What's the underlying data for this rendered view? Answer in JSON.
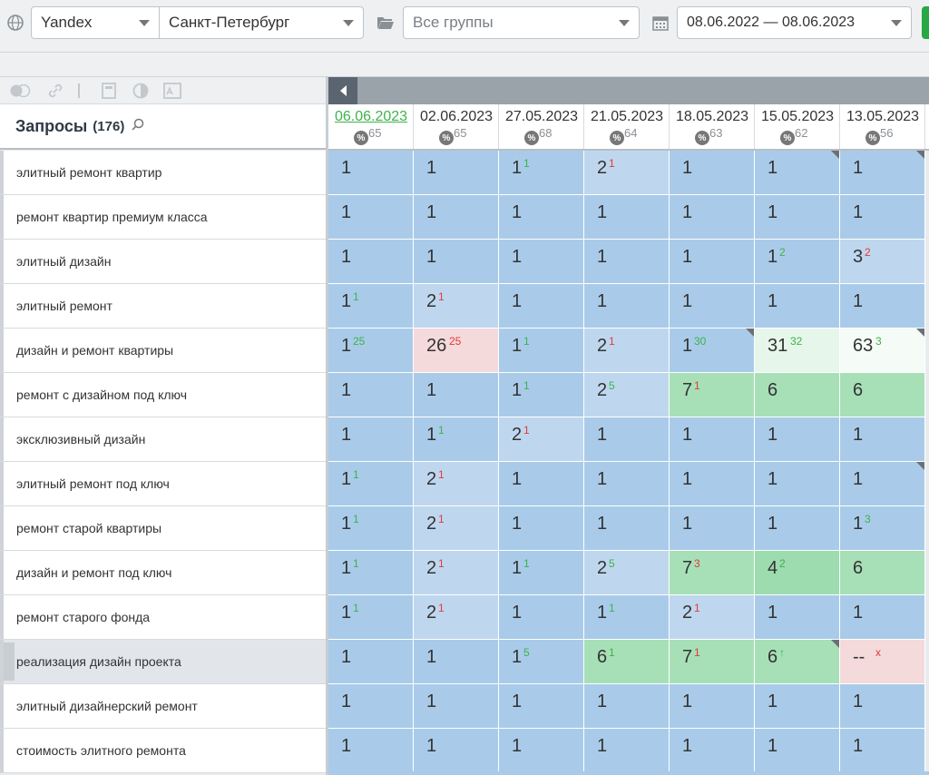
{
  "toolbar": {
    "engine": "Yandex",
    "city": "Санкт-Петербург",
    "groups_placeholder": "Все группы",
    "date_range": "08.06.2022 — 08.06.2023"
  },
  "queries_panel": {
    "title": "Запросы",
    "count": "(176)"
  },
  "columns": [
    {
      "date": "06.06.2023",
      "pct": "65",
      "highlight": true
    },
    {
      "date": "02.06.2023",
      "pct": "65"
    },
    {
      "date": "27.05.2023",
      "pct": "68"
    },
    {
      "date": "21.05.2023",
      "pct": "64"
    },
    {
      "date": "18.05.2023",
      "pct": "63"
    },
    {
      "date": "15.05.2023",
      "pct": "62"
    },
    {
      "date": "13.05.2023",
      "pct": "56"
    }
  ],
  "rows": [
    {
      "query": "элитный ремонт квартир",
      "cells": [
        {
          "v": "1",
          "c": "blue"
        },
        {
          "v": "1",
          "c": "blue"
        },
        {
          "v": "1",
          "d": "1",
          "dir": "up",
          "c": "blue"
        },
        {
          "v": "2",
          "d": "1",
          "dir": "down",
          "c": "lblue"
        },
        {
          "v": "1",
          "c": "blue"
        },
        {
          "v": "1",
          "c": "blue",
          "corner": true
        },
        {
          "v": "1",
          "c": "blue",
          "corner": true
        }
      ]
    },
    {
      "query": "ремонт квартир премиум класса",
      "cells": [
        {
          "v": "1",
          "c": "blue"
        },
        {
          "v": "1",
          "c": "blue"
        },
        {
          "v": "1",
          "c": "blue"
        },
        {
          "v": "1",
          "c": "blue"
        },
        {
          "v": "1",
          "c": "blue"
        },
        {
          "v": "1",
          "c": "blue"
        },
        {
          "v": "1",
          "c": "blue"
        }
      ]
    },
    {
      "query": "элитный дизайн",
      "cells": [
        {
          "v": "1",
          "c": "blue"
        },
        {
          "v": "1",
          "c": "blue"
        },
        {
          "v": "1",
          "c": "blue"
        },
        {
          "v": "1",
          "c": "blue"
        },
        {
          "v": "1",
          "c": "blue"
        },
        {
          "v": "1",
          "d": "2",
          "dir": "up",
          "c": "blue"
        },
        {
          "v": "3",
          "d": "2",
          "dir": "down",
          "c": "lblue"
        }
      ]
    },
    {
      "query": "элитный ремонт",
      "cells": [
        {
          "v": "1",
          "d": "1",
          "dir": "up",
          "c": "blue"
        },
        {
          "v": "2",
          "d": "1",
          "dir": "down",
          "c": "lblue"
        },
        {
          "v": "1",
          "c": "blue"
        },
        {
          "v": "1",
          "c": "blue"
        },
        {
          "v": "1",
          "c": "blue"
        },
        {
          "v": "1",
          "c": "blue"
        },
        {
          "v": "1",
          "c": "blue"
        }
      ]
    },
    {
      "query": "дизайн и ремонт квартиры",
      "cells": [
        {
          "v": "1",
          "d": "25",
          "dir": "up",
          "c": "blue"
        },
        {
          "v": "26",
          "d": "25",
          "dir": "down",
          "c": "pink"
        },
        {
          "v": "1",
          "d": "1",
          "dir": "up",
          "c": "blue"
        },
        {
          "v": "2",
          "d": "1",
          "dir": "down",
          "c": "lblue"
        },
        {
          "v": "1",
          "d": "30",
          "dir": "up",
          "c": "blue",
          "corner": true
        },
        {
          "v": "31",
          "d": "32",
          "dir": "up",
          "c": "pale"
        },
        {
          "v": "63",
          "d": "3",
          "dir": "up",
          "c": "white",
          "corner": true
        }
      ]
    },
    {
      "query": "ремонт с дизайном под ключ",
      "cells": [
        {
          "v": "1",
          "c": "blue"
        },
        {
          "v": "1",
          "c": "blue"
        },
        {
          "v": "1",
          "d": "1",
          "dir": "up",
          "c": "blue"
        },
        {
          "v": "2",
          "d": "5",
          "dir": "up",
          "c": "lblue"
        },
        {
          "v": "7",
          "d": "1",
          "dir": "down",
          "c": "green"
        },
        {
          "v": "6",
          "c": "green"
        },
        {
          "v": "6",
          "c": "green"
        }
      ]
    },
    {
      "query": "эксклюзивный дизайн",
      "cells": [
        {
          "v": "1",
          "c": "blue"
        },
        {
          "v": "1",
          "d": "1",
          "dir": "up",
          "c": "blue"
        },
        {
          "v": "2",
          "d": "1",
          "dir": "down",
          "c": "lblue"
        },
        {
          "v": "1",
          "c": "blue"
        },
        {
          "v": "1",
          "c": "blue"
        },
        {
          "v": "1",
          "c": "blue"
        },
        {
          "v": "1",
          "c": "blue"
        }
      ]
    },
    {
      "query": "элитный ремонт под ключ",
      "cells": [
        {
          "v": "1",
          "d": "1",
          "dir": "up",
          "c": "blue"
        },
        {
          "v": "2",
          "d": "1",
          "dir": "down",
          "c": "lblue"
        },
        {
          "v": "1",
          "c": "blue"
        },
        {
          "v": "1",
          "c": "blue"
        },
        {
          "v": "1",
          "c": "blue"
        },
        {
          "v": "1",
          "c": "blue"
        },
        {
          "v": "1",
          "c": "blue",
          "corner": true
        }
      ]
    },
    {
      "query": "ремонт старой квартиры",
      "cells": [
        {
          "v": "1",
          "d": "1",
          "dir": "up",
          "c": "blue"
        },
        {
          "v": "2",
          "d": "1",
          "dir": "down",
          "c": "lblue"
        },
        {
          "v": "1",
          "c": "blue"
        },
        {
          "v": "1",
          "c": "blue"
        },
        {
          "v": "1",
          "c": "blue"
        },
        {
          "v": "1",
          "c": "blue"
        },
        {
          "v": "1",
          "d": "3",
          "dir": "up",
          "c": "blue"
        }
      ]
    },
    {
      "query": "дизайн и ремонт под ключ",
      "cells": [
        {
          "v": "1",
          "d": "1",
          "dir": "up",
          "c": "blue"
        },
        {
          "v": "2",
          "d": "1",
          "dir": "down",
          "c": "lblue"
        },
        {
          "v": "1",
          "d": "1",
          "dir": "up",
          "c": "blue"
        },
        {
          "v": "2",
          "d": "5",
          "dir": "up",
          "c": "lblue"
        },
        {
          "v": "7",
          "d": "3",
          "dir": "down",
          "c": "green"
        },
        {
          "v": "4",
          "d": "2",
          "dir": "up",
          "c": "dgreen"
        },
        {
          "v": "6",
          "c": "green"
        }
      ]
    },
    {
      "query": "ремонт старого фонда",
      "cells": [
        {
          "v": "1",
          "d": "1",
          "dir": "up",
          "c": "blue"
        },
        {
          "v": "2",
          "d": "1",
          "dir": "down",
          "c": "lblue"
        },
        {
          "v": "1",
          "c": "blue"
        },
        {
          "v": "1",
          "d": "1",
          "dir": "up",
          "c": "blue"
        },
        {
          "v": "2",
          "d": "1",
          "dir": "down",
          "c": "lblue"
        },
        {
          "v": "1",
          "c": "blue"
        },
        {
          "v": "1",
          "c": "blue"
        }
      ]
    },
    {
      "query": "реализация дизайн проекта",
      "selected": true,
      "cells": [
        {
          "v": "1",
          "c": "blue"
        },
        {
          "v": "1",
          "c": "blue"
        },
        {
          "v": "1",
          "d": "5",
          "dir": "up",
          "c": "blue"
        },
        {
          "v": "6",
          "d": "1",
          "dir": "up",
          "c": "green"
        },
        {
          "v": "7",
          "d": "1",
          "dir": "down",
          "c": "green"
        },
        {
          "v": "6",
          "d": "↑",
          "dir": "up",
          "c": "green",
          "corner": true
        },
        {
          "v": "--",
          "d": "x",
          "dir": "down",
          "c": "pink"
        }
      ]
    },
    {
      "query": "элитный дизайнерский ремонт",
      "cells": [
        {
          "v": "1",
          "c": "blue"
        },
        {
          "v": "1",
          "c": "blue"
        },
        {
          "v": "1",
          "c": "blue"
        },
        {
          "v": "1",
          "c": "blue"
        },
        {
          "v": "1",
          "c": "blue"
        },
        {
          "v": "1",
          "c": "blue"
        },
        {
          "v": "1",
          "c": "blue"
        }
      ]
    },
    {
      "query": "стоимость элитного ремонта",
      "cells": [
        {
          "v": "1",
          "c": "blue"
        },
        {
          "v": "1",
          "c": "blue"
        },
        {
          "v": "1",
          "c": "blue"
        },
        {
          "v": "1",
          "c": "blue"
        },
        {
          "v": "1",
          "c": "blue"
        },
        {
          "v": "1",
          "c": "blue"
        },
        {
          "v": "1",
          "c": "blue"
        }
      ]
    }
  ],
  "colors": {
    "blue": "#a9cbe9",
    "light_blue": "#bfd7ee",
    "green": "#a7e0b7",
    "pink": "#f5dadb",
    "up": "#3cb34a",
    "down": "#e23b3b"
  }
}
